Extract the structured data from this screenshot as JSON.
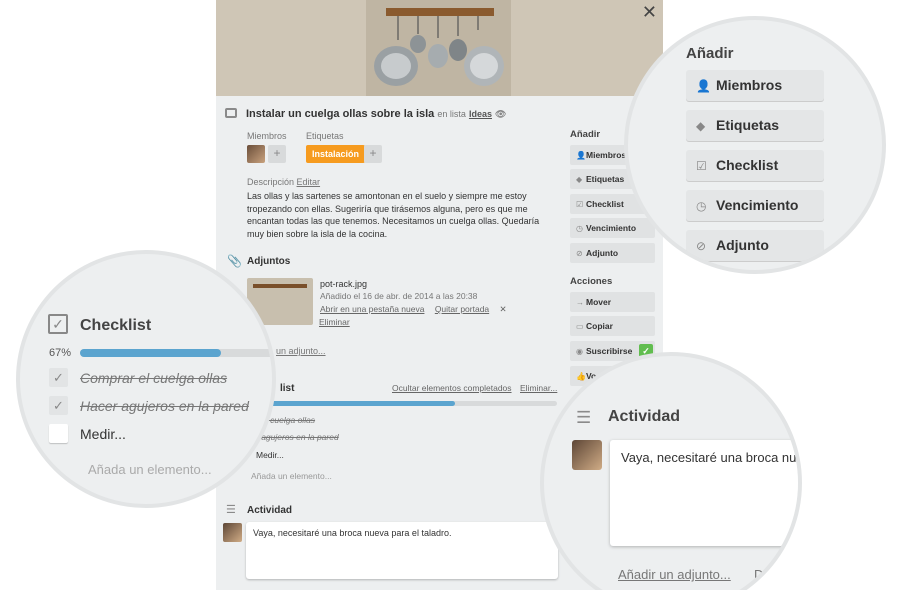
{
  "card": {
    "close_glyph": "✕",
    "title": "Instalar un cuelga ollas sobre la isla",
    "in_list": "en lista",
    "list_name": "Ideas",
    "members_label": "Miembros",
    "labels_label": "Etiquetas",
    "label_name": "Instalación",
    "plus": "+",
    "description_label": "Descripción",
    "edit_label": "Editar",
    "description": "Las ollas y las sartenes se amontonan en el suelo y siempre me estoy tropezando con ellas. Sugeriría que tirásemos alguna, pero es que me encantan todas las que tenemos. Necesitamos un cuelga ollas. Quedaría muy bien sobre la isla de la cocina.",
    "attachments_title": "Adjuntos",
    "attachment": {
      "name": "pot-rack.jpg",
      "added": "Añadido el 16 de abr. de 2014 a las 20:38",
      "open_tab": "Abrir en una pestaña nueva",
      "remove_cover": "Quitar portada",
      "x": "✕",
      "delete": "Eliminar"
    },
    "add_attachment": "un adjunto...",
    "checklist_title": "list",
    "hide_completed": "Ocultar elementos completados",
    "delete_checklist": "Eliminar...",
    "checklist_progress": 67,
    "items": [
      "r el cuelga ollas",
      "r agujeros en la pared",
      "Medir..."
    ],
    "add_item": "Añada un elemento...",
    "activity_title": "Actividad",
    "comment": "Vaya, necesitaré una broca nueva para el taladro."
  },
  "sidebar": {
    "add_heading": "Añadir",
    "add_buttons": [
      "Miembros",
      "Etiquetas",
      "Checklist",
      "Vencimiento",
      "Adjunto"
    ],
    "actions_heading": "Acciones",
    "action_buttons": [
      "Mover",
      "Copiar",
      "Suscribirse",
      "Vo"
    ],
    "check_glyph": "✓"
  },
  "zoom_add": {
    "heading": "Añadir",
    "buttons": [
      "Miembros",
      "Etiquetas",
      "Checklist",
      "Vencimiento",
      "Adjunto"
    ]
  },
  "zoom_checklist": {
    "title": "Checklist",
    "percent": "67%",
    "progress": 67,
    "items": [
      "Comprar el cuelga ollas",
      "Hacer agujeros en la pared",
      "Medir..."
    ],
    "add_item": "Añada un elemento..."
  },
  "zoom_activity": {
    "title": "Actividad",
    "comment": "Vaya, necesitaré una broca nueva para el taladro.",
    "add_attachment": "Añadir un adjunto...",
    "trailing": "D"
  },
  "colors": {
    "label_orange": "#f69b1f",
    "progress_blue": "#5ba4cf",
    "subscribed_green": "#61bd4f"
  }
}
